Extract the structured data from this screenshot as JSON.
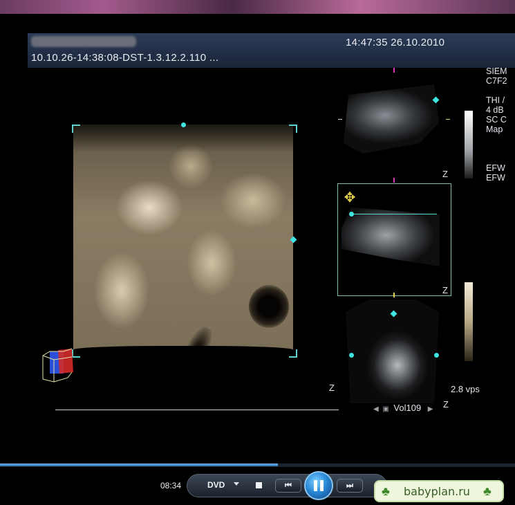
{
  "header": {
    "timestamp": "14:47:35 26.10.2010",
    "study_id": "10.10.26-14:38:08-DST-1.3.12.2.110 ..."
  },
  "side_info": {
    "lines": [
      "SIEM",
      "C7F2",
      "",
      "THI /",
      "4 dB",
      "SC C",
      "Map",
      "",
      "",
      "",
      "EFW",
      "EFW"
    ]
  },
  "viewport": {
    "z_labels": [
      "Z",
      "Z",
      "Z",
      "Z"
    ],
    "volume_rate": "2.8 vps",
    "volume_label": "Vol109"
  },
  "player": {
    "elapsed_time": "08:34",
    "source_label": "DVD",
    "prev_label": "⏮",
    "next_label": "⏭",
    "progress": 0.54,
    "state": "playing"
  },
  "watermark": {
    "text": "babyplan.ru",
    "icon": "clover-icon"
  },
  "colors": {
    "accent_cyan": "#3fe3e0",
    "seek_blue": "#2c6fb6",
    "header_navy": "#1a2438"
  }
}
